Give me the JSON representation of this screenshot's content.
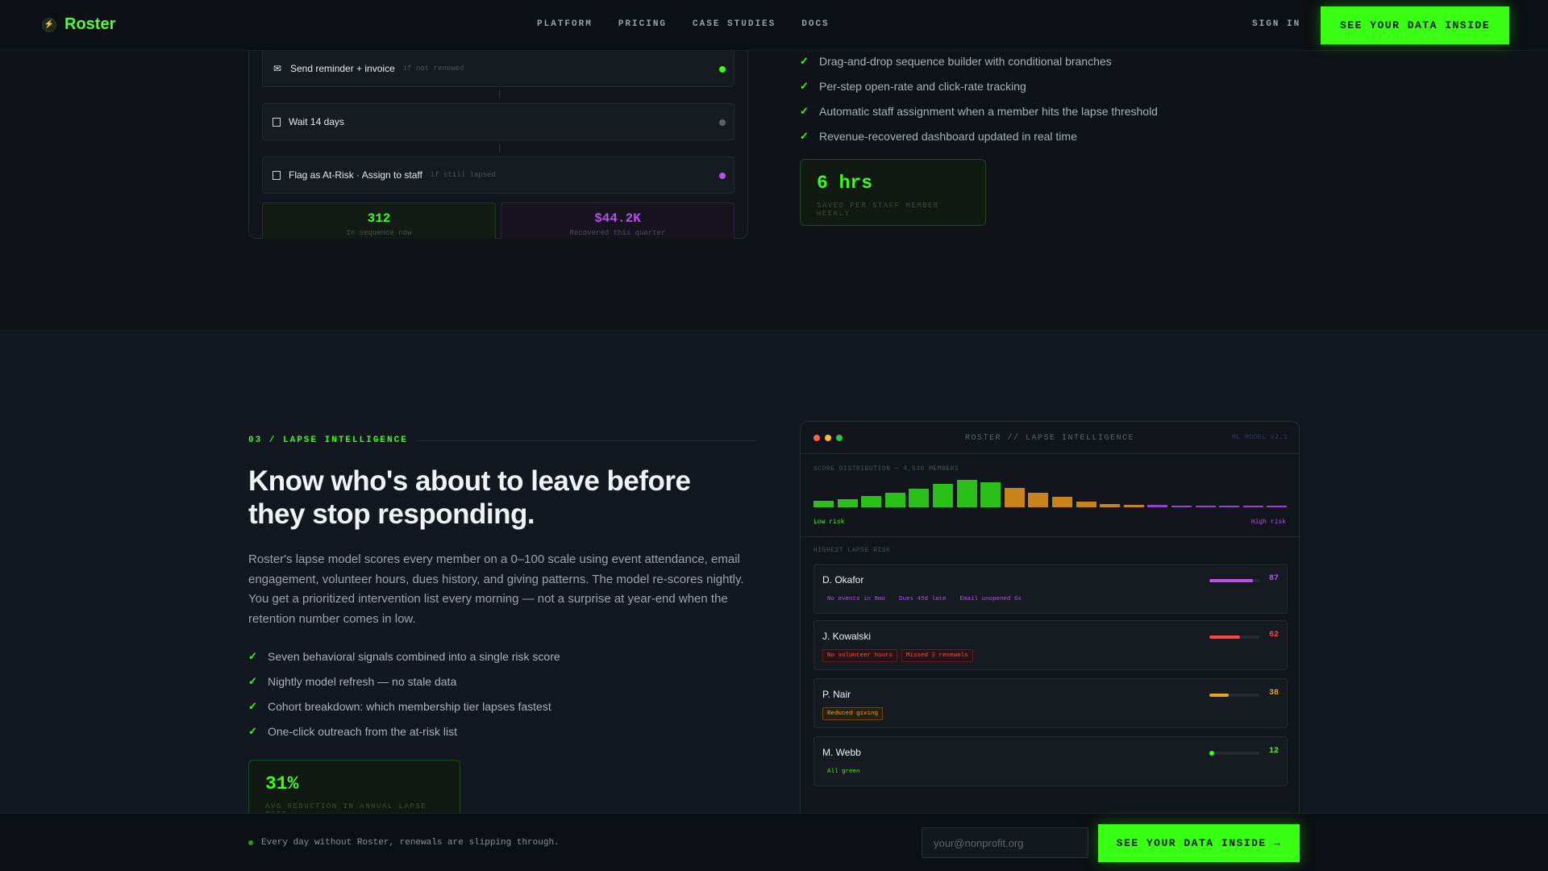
{
  "nav": {
    "brand": "Roster",
    "links": [
      "PLATFORM",
      "PRICING",
      "CASE STUDIES",
      "DOCS"
    ],
    "signin": "SIGN IN",
    "cta": "SEE YOUR DATA INSIDE"
  },
  "sequence": {
    "steps": [
      {
        "label": "Send reminder + invoice",
        "condition": "if not renewed",
        "icon": "envelope-icon",
        "status_color": "#39ff14"
      },
      {
        "label": "Wait 14 days",
        "condition": "",
        "icon": "wait-icon",
        "status_color": "#5c636c"
      },
      {
        "label": "Flag as At-Risk · Assign to staff",
        "condition": "if still lapsed",
        "icon": "flag-icon",
        "status_color": "#b84ff0"
      }
    ],
    "stats": [
      {
        "value": "312",
        "label": "In sequence now",
        "color": "#39ff14"
      },
      {
        "value": "$44.2K",
        "label": "Recovered this quarter",
        "color": "#b84ff0"
      }
    ]
  },
  "automation_features": [
    "Drag-and-drop sequence builder with conditional branches",
    "Per-step open-rate and click-rate tracking",
    "Automatic staff assignment when a member hits the lapse threshold",
    "Revenue-recovered dashboard updated in real time"
  ],
  "automation_kpi": {
    "value": "6 hrs",
    "label": "SAVED PER STAFF MEMBER WEEKLY"
  },
  "lapse": {
    "eyebrow": "03 / LAPSE INTELLIGENCE",
    "headline": "Know who's about to leave before they stop responding.",
    "paragraph": "Roster's lapse model scores every member on a 0–100 scale using event attendance, email engagement, volunteer hours, dues history, and giving patterns. The model re-scores nightly. You get a prioritized intervention list every morning — not a surprise at year-end when the retention number comes in low.",
    "features": [
      "Seven behavioral signals combined into a single risk score",
      "Nightly model refresh — no stale data",
      "Cohort breakdown: which membership tier lapses fastest",
      "One-click outreach from the at-risk list"
    ],
    "kpi": {
      "value": "31%",
      "label": "AVG REDUCTION IN ANNUAL LAPSE RATE"
    }
  },
  "panel": {
    "title": "ROSTER // LAPSE INTELLIGENCE",
    "model": "ML MODEL v2.1",
    "distribution_label": "SCORE DISTRIBUTION — 4,530 MEMBERS",
    "low_label": "Low risk",
    "high_label": "High risk",
    "highest_label": "HIGHEST LAPSE RISK",
    "distribution": [
      {
        "level": 0.18,
        "color": "#2bbf1a"
      },
      {
        "level": 0.24,
        "color": "#2bbf1a"
      },
      {
        "level": 0.34,
        "color": "#2bbf1a"
      },
      {
        "level": 0.42,
        "color": "#2bbf1a"
      },
      {
        "level": 0.55,
        "color": "#2bbf1a"
      },
      {
        "level": 0.7,
        "color": "#2bbf1a"
      },
      {
        "level": 0.82,
        "color": "#2bbf1a"
      },
      {
        "level": 0.74,
        "color": "#2bbf1a"
      },
      {
        "level": 0.56,
        "color": "#c8841a"
      },
      {
        "level": 0.42,
        "color": "#c8841a"
      },
      {
        "level": 0.3,
        "color": "#c8841a"
      },
      {
        "level": 0.16,
        "color": "#c8841a"
      },
      {
        "level": 0.1,
        "color": "#c8841a"
      },
      {
        "level": 0.08,
        "color": "#c8841a"
      },
      {
        "level": 0.06,
        "color": "#9a3fd0"
      },
      {
        "level": 0.05,
        "color": "#9a3fd0"
      },
      {
        "level": 0.04,
        "color": "#9a3fd0"
      },
      {
        "level": 0.03,
        "color": "#9a3fd0"
      },
      {
        "level": 0.03,
        "color": "#9a3fd0"
      },
      {
        "level": 0.03,
        "color": "#9a3fd0"
      }
    ],
    "members": [
      {
        "name": "D. Okafor",
        "score": "87",
        "fill": 0.87,
        "color": "#b84ff0",
        "tags": [
          {
            "text": "No events in 8mo",
            "style": "purple"
          },
          {
            "text": "Dues 45d late",
            "style": "purple"
          },
          {
            "text": "Email unopened 6x",
            "style": "purple"
          }
        ]
      },
      {
        "name": "J. Kowalski",
        "score": "62",
        "fill": 0.62,
        "color": "#ff4444",
        "tags": [
          {
            "text": "No volunteer hours",
            "style": "red"
          },
          {
            "text": "Missed 2 renewals",
            "style": "red"
          }
        ]
      },
      {
        "name": "P. Nair",
        "score": "38",
        "fill": 0.38,
        "color": "#f0a020",
        "tags": [
          {
            "text": "Reduced giving",
            "style": "amber"
          }
        ]
      },
      {
        "name": "M. Webb",
        "score": "12",
        "fill": 0.12,
        "color": "#39ff14",
        "tags": [
          {
            "text": "All green",
            "style": "green"
          }
        ]
      }
    ]
  },
  "bottom_bar": {
    "message": "Every day without Roster, renewals are slipping through.",
    "email_placeholder": "your@nonprofit.org",
    "cta": "SEE YOUR DATA INSIDE →"
  }
}
